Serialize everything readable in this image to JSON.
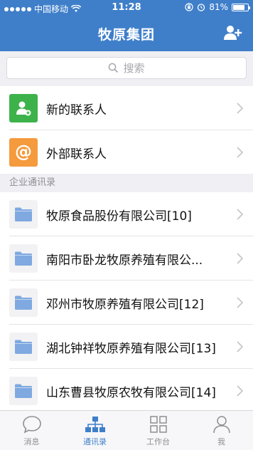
{
  "status": {
    "carrier": "中国移动",
    "time": "11:28",
    "battery": "81%",
    "battery_level": 0.81
  },
  "nav": {
    "title": "牧原集团"
  },
  "search": {
    "placeholder": "搜索"
  },
  "top_items": [
    {
      "label": "新的联系人",
      "color": "#3db24b",
      "icon": "new-contact-icon"
    },
    {
      "label": "外部联系人",
      "color": "#f59a3d",
      "icon": "external-contact-icon"
    }
  ],
  "section_header": "企业通讯录",
  "departments": [
    {
      "label": "牧原食品股份有限公司[10]"
    },
    {
      "label": "南阳市卧龙牧原养殖有限公..."
    },
    {
      "label": "邓州市牧原养殖有限公司[12]"
    },
    {
      "label": "湖北钟祥牧原养殖有限公司[13]"
    },
    {
      "label": "山东曹县牧原农牧有限公司[14]"
    }
  ],
  "tabs": [
    {
      "label": "消息",
      "icon": "chat-bubble-icon",
      "active": false
    },
    {
      "label": "通讯录",
      "icon": "org-chart-icon",
      "active": true
    },
    {
      "label": "工作台",
      "icon": "grid-icon",
      "active": false
    },
    {
      "label": "我",
      "icon": "person-icon",
      "active": false
    }
  ],
  "colors": {
    "brand": "#3f7fca",
    "folder": "#7fa9e0"
  }
}
